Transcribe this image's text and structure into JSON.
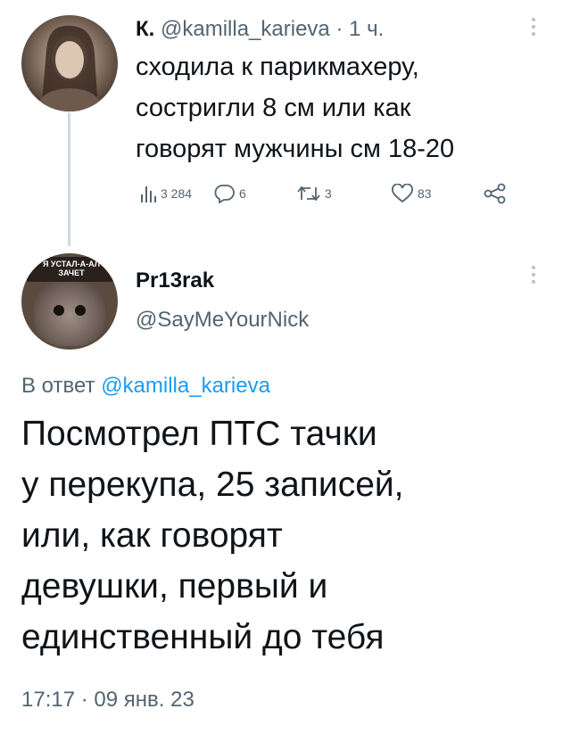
{
  "tweet": {
    "author_name": "К.",
    "author_handle": "@kamilla_karieva",
    "separator": "·",
    "time": "1 ч.",
    "text_lines": [
      "сходила к парикмахеру,",
      "состригли 8 см или как",
      "говорят мужчины см 18-20"
    ],
    "stats": {
      "views": "3 284",
      "replies": "6",
      "retweets": "3",
      "likes": "83"
    }
  },
  "reply": {
    "author_name": "Pr13rak",
    "author_handle": "@SayMeYourNick",
    "avatar_sign_lines": [
      "Я УСТАЛ-А-АЛ",
      "ЗАЧЕТ"
    ],
    "reply_prefix": "В ответ",
    "reply_mention": "@kamilla_karieva",
    "text_lines": [
      "Посмотрел ПТС тачки",
      "у перекупа, 25 записей,",
      "или, как говорят",
      "девушки, первый и",
      "единственный до тебя"
    ],
    "time": "17:17",
    "separator": "·",
    "date": "09 янв. 23"
  },
  "icons": {
    "views": "bar-chart-icon",
    "reply": "comment-bubble-icon",
    "retweet": "retweet-icon",
    "like": "heart-icon",
    "share": "share-nodes-icon",
    "more": "more-vertical-icon"
  },
  "colors": {
    "text": "#0f1419",
    "secondary": "#536471",
    "link": "#1d9bf0",
    "thread_line": "#cfd9de"
  }
}
